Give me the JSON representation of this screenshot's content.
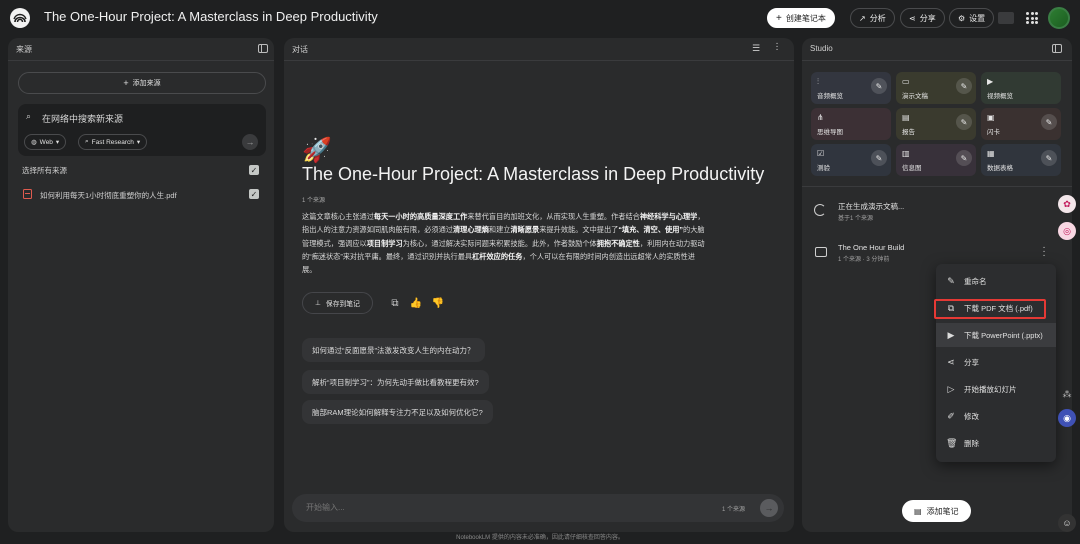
{
  "header": {
    "title": "The One-Hour Project: A Masterclass in Deep Productivity",
    "create_notebook": "创建笔记本",
    "analyze": "分析",
    "share": "分享",
    "settings": "设置"
  },
  "sources": {
    "heading": "来源",
    "add_source": "添加来源",
    "search_placeholder": "在网络中搜索新来源",
    "web_pill": "Web",
    "research_pill": "Fast Research",
    "select_all": "选择所有来源",
    "files": [
      {
        "name": "如何利用每天1小时彻底重塑你的人生.pdf",
        "checked": true
      }
    ]
  },
  "chat": {
    "heading": "对话",
    "emoji": "🚀",
    "title": "The One-Hour Project: A Masterclass in Deep Productivity",
    "source_count": "1 个来源",
    "summary_parts": [
      {
        "t": "这篇文章核心主张通过",
        "b": false
      },
      {
        "t": "每天一小时的高质量深度工作",
        "b": true
      },
      {
        "t": "来替代盲目的加班文化，从而实现人生重塑。作者结合",
        "b": false
      },
      {
        "t": "神经科学与心理学",
        "b": true
      },
      {
        "t": "，指出人的注意力资源如同肌肉般有限，必须通过",
        "b": false
      },
      {
        "t": "清理心理熵",
        "b": true
      },
      {
        "t": "和建立",
        "b": false
      },
      {
        "t": "清晰愿景",
        "b": true
      },
      {
        "t": "来提升效能。文中提出了",
        "b": false
      },
      {
        "t": "“填充、清空、使用”",
        "b": true
      },
      {
        "t": "的大脑管理模式，强调应以",
        "b": false
      },
      {
        "t": "项目制学习",
        "b": true
      },
      {
        "t": "为核心，通过解决实际问题来积累技能。此外，作者鼓励个体",
        "b": false
      },
      {
        "t": "拥抱不确定性",
        "b": true
      },
      {
        "t": "，利用内在动力驱动的“痴迷状态”来对抗平庸。最终，通过识别并执行最具",
        "b": false
      },
      {
        "t": "杠杆效应的任务",
        "b": true
      },
      {
        "t": "，个人可以在有限的时间内创造出远超常人的实质性进展。",
        "b": false
      }
    ],
    "save_note": "保存到笔记",
    "suggestions": [
      "如何通过“反面愿景”法激发改变人生的内在动力？",
      "解析“项目制学习”：为何先动手做比看教程更有效?",
      "脑部RAM理论如何解释专注力不足以及如何优化它?"
    ],
    "input_placeholder": "开始输入...",
    "input_source_count": "1 个来源"
  },
  "studio": {
    "heading": "Studio",
    "tiles": [
      {
        "label": "音频概览",
        "icon": "audio-icon",
        "glyph": "⫶",
        "color": "#33363f",
        "edit": true
      },
      {
        "label": "演示文稿",
        "icon": "slides-icon",
        "glyph": "▭",
        "color": "#3a3b2e",
        "edit": true
      },
      {
        "label": "视频概览",
        "icon": "video-icon",
        "glyph": "▶",
        "color": "#313a33",
        "edit": false
      },
      {
        "label": "思维导图",
        "icon": "mindmap-icon",
        "glyph": "⋔",
        "color": "#3c3035",
        "edit": false
      },
      {
        "label": "报告",
        "icon": "report-icon",
        "glyph": "▤",
        "color": "#3a3a2e",
        "edit": true
      },
      {
        "label": "闪卡",
        "icon": "flashcard-icon",
        "glyph": "▣",
        "color": "#3a3130",
        "edit": true
      },
      {
        "label": "测验",
        "icon": "quiz-icon",
        "glyph": "☑",
        "color": "#30353e",
        "edit": true
      },
      {
        "label": "信息图",
        "icon": "infographic-icon",
        "glyph": "▥",
        "color": "#38313a",
        "edit": true
      },
      {
        "label": "数据表格",
        "icon": "table-icon",
        "glyph": "▦",
        "color": "#30353d",
        "edit": true
      }
    ],
    "generating_title": "正在生成演示文稿...",
    "generating_sub": "基于1 个来源",
    "item_title": "The One Hour Build",
    "item_sub": "1 个来源 · 3 分钟前",
    "menu": [
      {
        "label": "重命名",
        "icon": "edit-icon",
        "glyph": "✎"
      },
      {
        "label": "下载 PDF 文档 (.pdf)",
        "icon": "pdf-icon",
        "glyph": "⧉"
      },
      {
        "label": "下载 PowerPoint (.pptx)",
        "icon": "pptx-icon",
        "glyph": "▶"
      },
      {
        "label": "分享",
        "icon": "share-icon",
        "glyph": "⋖"
      },
      {
        "label": "开始播放幻灯片",
        "icon": "play-icon",
        "glyph": "▷"
      },
      {
        "label": "修改",
        "icon": "modify-icon",
        "glyph": "✐"
      },
      {
        "label": "删除",
        "icon": "delete-icon",
        "glyph": "🗑"
      }
    ],
    "add_note": "添加笔记"
  },
  "footer": "NotebookLM 提供的内容未必准确，因此请仔细核查回答内容。"
}
